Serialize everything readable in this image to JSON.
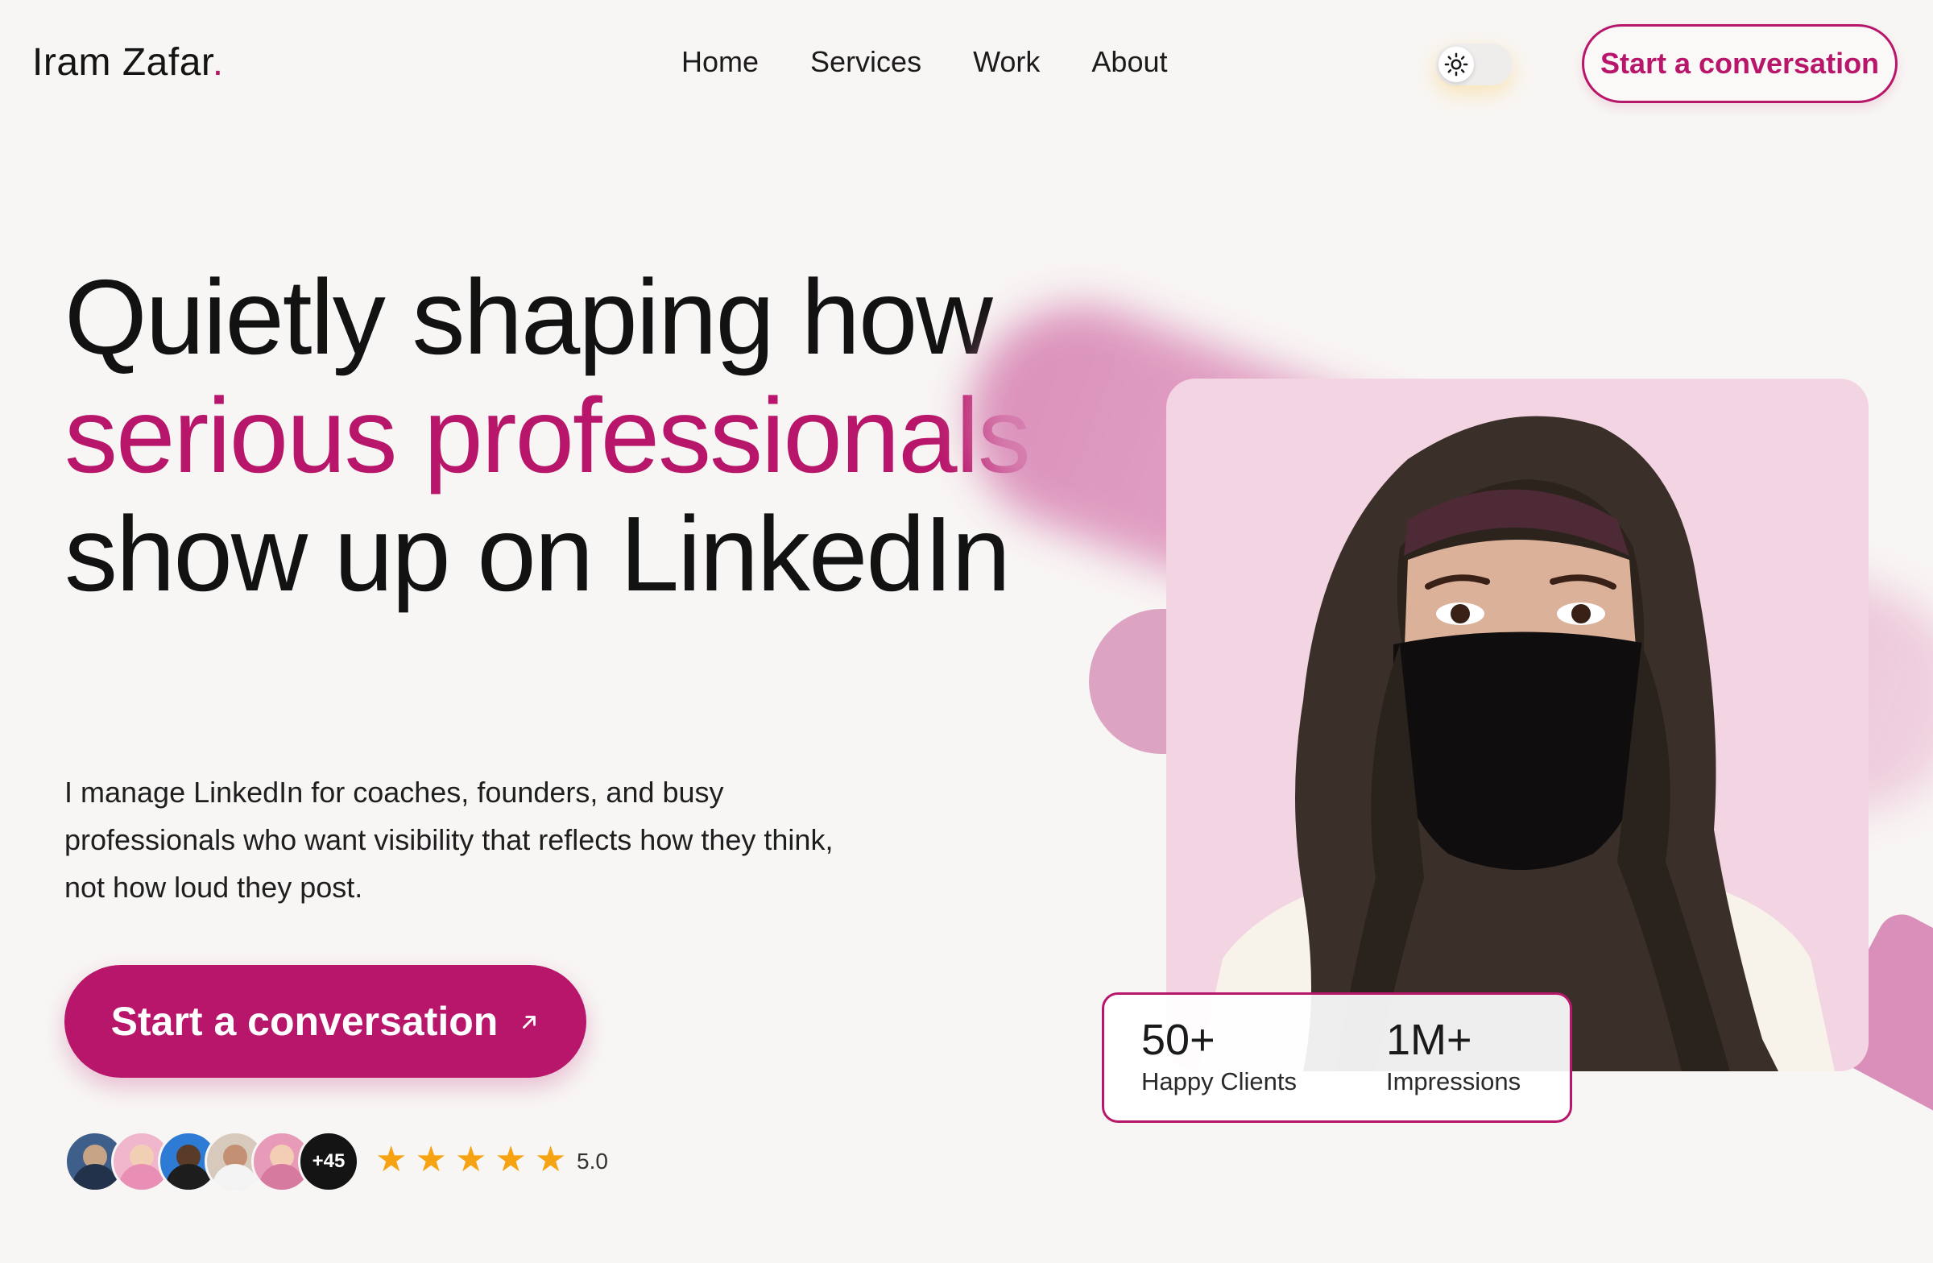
{
  "nav": {
    "logo_name": "Iram Zafar",
    "logo_dot": ".",
    "links": [
      "Home",
      "Services",
      "Work",
      "About"
    ],
    "theme_toggle_icon": "sun-icon",
    "cta_label": "Start a conversation"
  },
  "hero": {
    "headline_part1": "Quietly shaping how ",
    "headline_accent": "serious professionals",
    "headline_part2": " show up on LinkedIn",
    "subcopy": "I manage LinkedIn for coaches, founders, and busy professionals who want visibility that reflects how they think, not how loud they post.",
    "cta_label": "Start a conversation",
    "cta_icon": "arrow-up-right-icon"
  },
  "social_proof": {
    "more_count": "+45",
    "stars": 5,
    "rating": "5.0"
  },
  "stats": [
    {
      "value": "50+",
      "label": "Happy Clients"
    },
    {
      "value": "1M+",
      "label": "Impressions"
    }
  ],
  "colors": {
    "accent": "#b8166a",
    "background": "#f8f6f4",
    "star": "#f5a213",
    "portrait_bg": "#f3d4e2"
  }
}
